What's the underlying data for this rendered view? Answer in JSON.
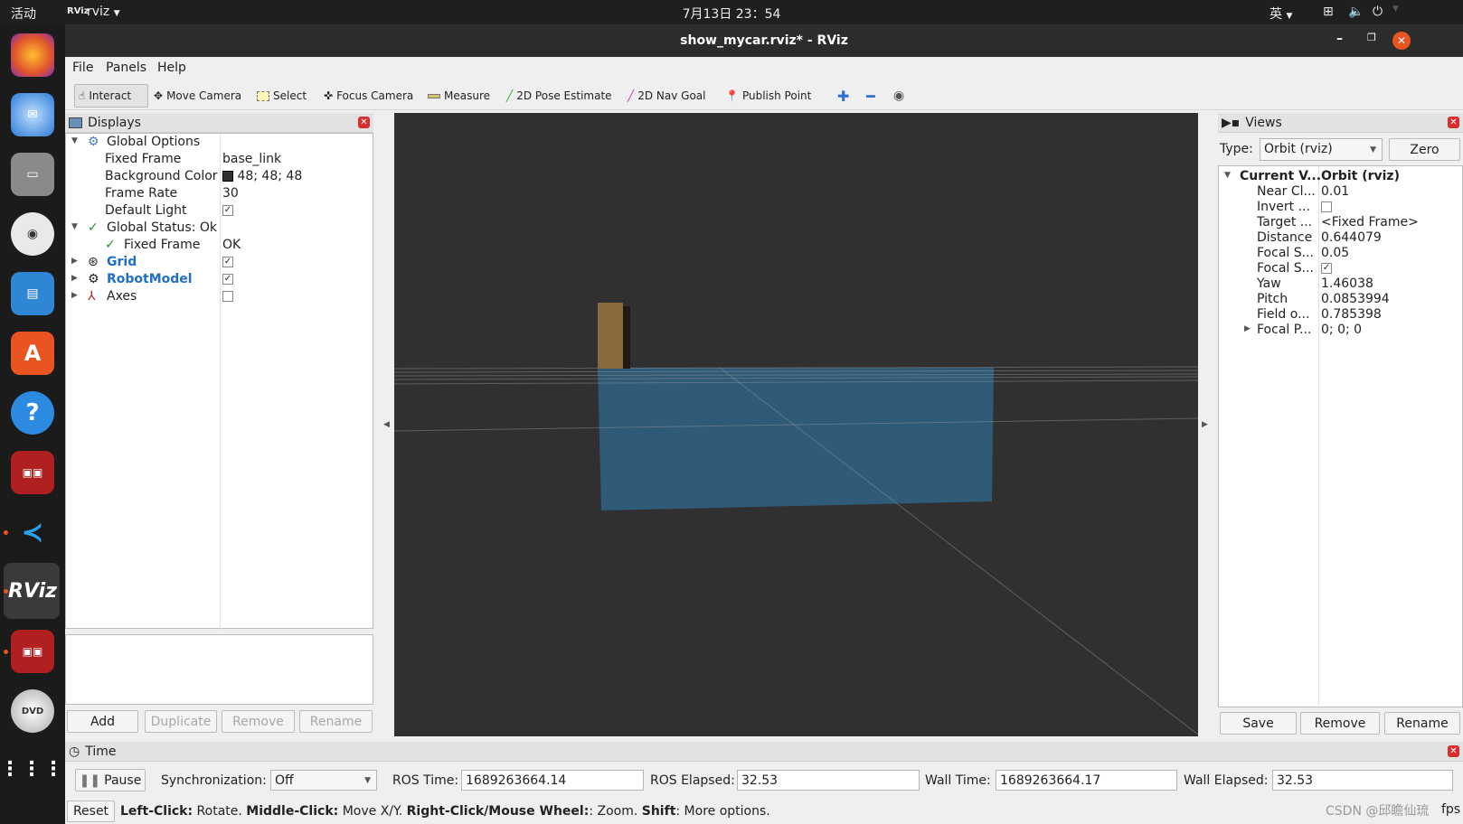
{
  "topbar": {
    "activities": "活动",
    "app_name": "rviz",
    "app_logo": "RViz",
    "clock": "7月13日 23：54",
    "input_method": "英"
  },
  "window": {
    "title": "show_mycar.rviz* - RViz"
  },
  "menu": {
    "file": "File",
    "panels": "Panels",
    "help": "Help"
  },
  "toolbar": {
    "interact": "Interact",
    "move_camera": "Move Camera",
    "select": "Select",
    "focus_camera": "Focus Camera",
    "measure": "Measure",
    "pose_estimate": "2D Pose Estimate",
    "nav_goal": "2D Nav Goal",
    "publish_point": "Publish Point"
  },
  "displays": {
    "title": "Displays",
    "global_options": "Global Options",
    "fixed_frame_label": "Fixed Frame",
    "fixed_frame_value": "base_link",
    "bg_color_label": "Background Color",
    "bg_color_value": "48; 48; 48",
    "frame_rate_label": "Frame Rate",
    "frame_rate_value": "30",
    "default_light_label": "Default Light",
    "global_status": "Global Status: Ok",
    "status_fixed_frame_label": "Fixed Frame",
    "status_fixed_frame_value": "OK",
    "grid": "Grid",
    "robot_model": "RobotModel",
    "axes": "Axes",
    "buttons": {
      "add": "Add",
      "duplicate": "Duplicate",
      "remove": "Remove",
      "rename": "Rename"
    }
  },
  "views": {
    "title": "Views",
    "type_label": "Type:",
    "type_value": "Orbit (rviz)",
    "zero": "Zero",
    "current_view_label": "Current V...",
    "current_view_value": "Orbit (rviz)",
    "props": [
      {
        "k": "Near Cl...",
        "v": "0.01"
      },
      {
        "k": "Invert ...",
        "v": ""
      },
      {
        "k": "Target ...",
        "v": "<Fixed Frame>"
      },
      {
        "k": "Distance",
        "v": "0.644079"
      },
      {
        "k": "Focal S...",
        "v": "0.05"
      },
      {
        "k": "Focal S...",
        "v": ""
      },
      {
        "k": "Yaw",
        "v": "1.46038"
      },
      {
        "k": "Pitch",
        "v": "0.0853994"
      },
      {
        "k": "Field o...",
        "v": "0.785398"
      },
      {
        "k": "Focal P...",
        "v": "0; 0; 0"
      }
    ],
    "buttons": {
      "save": "Save",
      "remove": "Remove",
      "rename": "Rename"
    }
  },
  "time": {
    "title": "Time",
    "pause": "Pause",
    "sync_label": "Synchronization:",
    "sync_value": "Off",
    "ros_time_label": "ROS Time:",
    "ros_time_value": "1689263664.14",
    "ros_elapsed_label": "ROS Elapsed:",
    "ros_elapsed_value": "32.53",
    "wall_time_label": "Wall Time:",
    "wall_time_value": "1689263664.17",
    "wall_elapsed_label": "Wall Elapsed:",
    "wall_elapsed_value": "32.53"
  },
  "statusbar": {
    "reset": "Reset",
    "left_click": "Left-Click:",
    "rotate": " Rotate. ",
    "middle_click": "Middle-Click:",
    "move": " Move X/Y. ",
    "right_click": "Right-Click/Mouse Wheel:",
    "zoom": ": Zoom. ",
    "shift": "Shift",
    "more": ": More options.",
    "fps": "fps",
    "watermark": "CSDN @邱瞻仙琉"
  },
  "colors": {
    "viewport_bg": "#303030",
    "plane": "#2f5a78",
    "box": "#8a6a3c",
    "accent": "#e95420"
  }
}
